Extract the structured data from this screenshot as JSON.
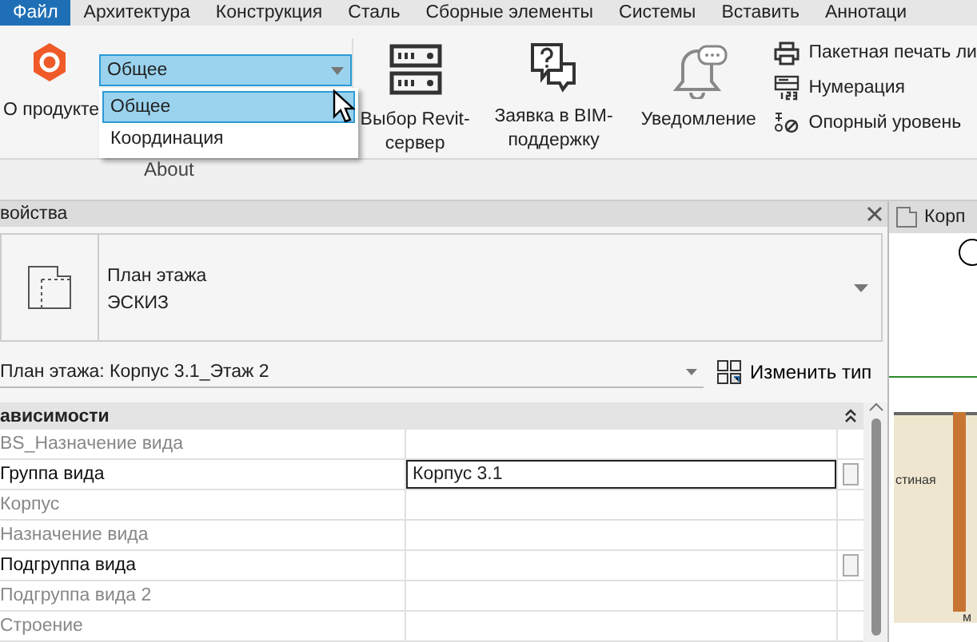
{
  "menu_tabs": [
    {
      "label": "Файл",
      "selected": true
    },
    {
      "label": "Архитектура",
      "selected": false
    },
    {
      "label": "Конструкция",
      "selected": false
    },
    {
      "label": "Сталь",
      "selected": false
    },
    {
      "label": "Сборные элементы",
      "selected": false
    },
    {
      "label": "Системы",
      "selected": false
    },
    {
      "label": "Вставить",
      "selected": false
    },
    {
      "label": "Аннотаци",
      "selected": false
    }
  ],
  "ribbon": {
    "about_button": "О продукте",
    "dropdown": {
      "value": "Общее",
      "expanded": true,
      "options": [
        {
          "label": "Общее",
          "selected": true
        },
        {
          "label": "Координация",
          "selected": false
        }
      ]
    },
    "panel_label": "About",
    "large_buttons": [
      {
        "kind": "server",
        "label": "Выбор Revit-сервер"
      },
      {
        "kind": "support",
        "label": "Заявка в BIM-поддержку"
      },
      {
        "kind": "bell",
        "label": "Уведомление"
      }
    ],
    "small_buttons": [
      {
        "kind": "printer",
        "label": "Пакетная печать ли"
      },
      {
        "kind": "numbering",
        "label": "Нумерация"
      },
      {
        "kind": "level",
        "label": "Опорный уровень"
      }
    ]
  },
  "properties": {
    "title": "войства",
    "type_selector": {
      "family": "План этажа",
      "type": "ЭСКИЗ"
    },
    "instance": "План этажа: Корпус 3.1_Этаж 2",
    "edit_type": "Изменить тип",
    "section": "ависимости",
    "rows": [
      {
        "name": "BS_Назначение вида",
        "value": "",
        "disabled": true,
        "editing": false
      },
      {
        "name": "Группа вида",
        "value": "Корпус 3.1",
        "disabled": false,
        "editing": true
      },
      {
        "name": "Корпус",
        "value": "",
        "disabled": true,
        "editing": false
      },
      {
        "name": "Назначение вида",
        "value": "",
        "disabled": true,
        "editing": false
      },
      {
        "name": "Подгруппа вида",
        "value": "",
        "disabled": false,
        "editing": false
      },
      {
        "name": "Подгруппа вида 2",
        "value": "",
        "disabled": true,
        "editing": false
      },
      {
        "name": "Строение",
        "value": "",
        "disabled": true,
        "editing": false
      }
    ]
  },
  "view": {
    "tab": "Корп",
    "labels": [
      "стиная",
      "м"
    ]
  }
}
